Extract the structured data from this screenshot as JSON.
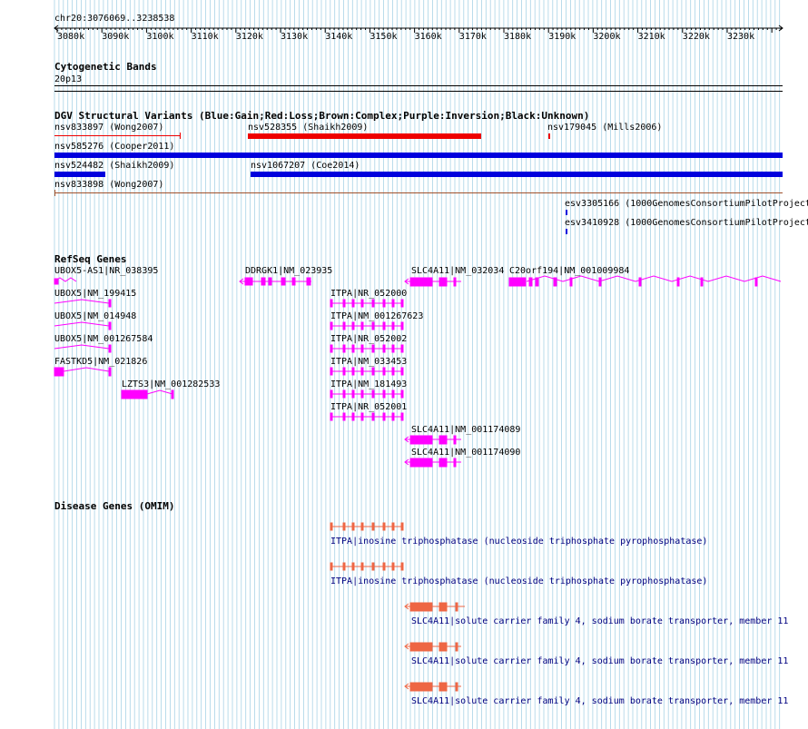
{
  "location": "chr20:3076069..3238538",
  "ruler": {
    "ticks": [
      "3080k",
      "3090k",
      "3100k",
      "3110k",
      "3120k",
      "3130k",
      "3140k",
      "3150k",
      "3160k",
      "3170k",
      "3180k",
      "3190k",
      "3200k",
      "3210k",
      "3220k",
      "3230k"
    ]
  },
  "cytoband": {
    "title": "Cytogenetic Bands",
    "band": "20p13"
  },
  "dgv": {
    "title": "DGV Structural Variants (Blue:Gain;Red:Loss;Brown:Complex;Purple:Inversion;Black:Unknown)",
    "features": [
      {
        "label": "nsv833897 (Wong2007)"
      },
      {
        "label": "nsv528355 (Shaikh2009)"
      },
      {
        "label": "nsv179045 (Mills2006)"
      },
      {
        "label": "nsv585276 (Cooper2011)"
      },
      {
        "label": "nsv524482 (Shaikh2009)"
      },
      {
        "label": "nsv1067207 (Coe2014)"
      },
      {
        "label": "nsv833898 (Wong2007)"
      },
      {
        "label": "esv3305166 (1000GenomesConsortiumPilotProject"
      },
      {
        "label": "esv3410928 (1000GenomesConsortiumPilotProject"
      }
    ]
  },
  "refseq": {
    "title": "RefSeq Genes",
    "genes": [
      {
        "label": "UBOX5-AS1|NR_038395"
      },
      {
        "label": "DDRGK1|NM_023935"
      },
      {
        "label": "SLC4A11|NM_032034"
      },
      {
        "label": "C20orf194|NM_001009984"
      },
      {
        "label": "UBOX5|NM_199415"
      },
      {
        "label": "ITPA|NR_052000"
      },
      {
        "label": "UBOX5|NM_014948"
      },
      {
        "label": "ITPA|NM_001267623"
      },
      {
        "label": "UBOX5|NM_001267584"
      },
      {
        "label": "ITPA|NR_052002"
      },
      {
        "label": "FASTKD5|NM_021826"
      },
      {
        "label": "ITPA|NM_033453"
      },
      {
        "label": "LZTS3|NM_001282533"
      },
      {
        "label": "ITPA|NM_181493"
      },
      {
        "label": "ITPA|NR_052001"
      },
      {
        "label": "SLC4A11|NM_001174089"
      },
      {
        "label": "SLC4A11|NM_001174090"
      }
    ]
  },
  "omim": {
    "title": "Disease Genes (OMIM)",
    "entries": [
      {
        "label": "ITPA|inosine triphosphatase (nucleoside triphosphate pyrophosphatase)"
      },
      {
        "label": "ITPA|inosine triphosphatase (nucleoside triphosphate pyrophosphatase)"
      },
      {
        "label": "SLC4A11|solute carrier family 4, sodium borate transporter, member 11"
      },
      {
        "label": "SLC4A11|solute carrier family 4, sodium borate transporter, member 11"
      },
      {
        "label": "SLC4A11|solute carrier family 4, sodium borate transporter, member 11"
      }
    ]
  },
  "colors": {
    "grid": "#a9d3e6",
    "gain": "#0000dd",
    "loss": "#ee0000",
    "complex": "#a0522d",
    "refseq": "#ff00ff",
    "omim": "#ee6644",
    "omim_text": "#000080"
  }
}
